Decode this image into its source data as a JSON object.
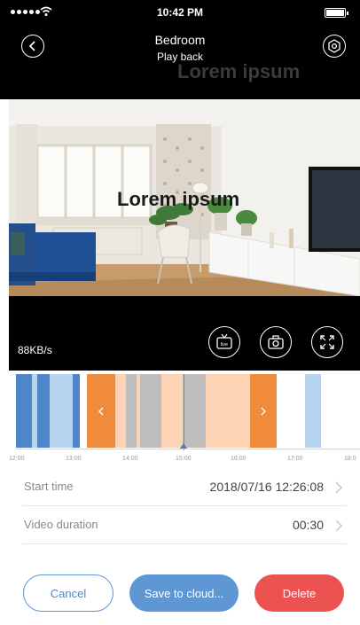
{
  "status_bar": {
    "time": "10:42 PM"
  },
  "nav": {
    "title": "Bedroom",
    "subtitle": "Play back"
  },
  "overlays": {
    "text_1": "Lorem ipsum",
    "text_2": "Lorem ipsum"
  },
  "player": {
    "bitrate": "88KB/s",
    "controls": [
      "live-icon",
      "camera-icon",
      "fullscreen-icon"
    ]
  },
  "timeline": {
    "ticks": [
      "12:00",
      "13:00",
      "14:00",
      "15:00",
      "16:00",
      "17:00",
      "18:0"
    ],
    "colors": {
      "blue": "#4f86c9",
      "light_blue": "#b7d4ee",
      "orange": "#ef8b3a",
      "peach": "#fcd4b5",
      "gray": "#bdbdbd"
    }
  },
  "details": {
    "start_time_label": "Start time",
    "start_time_value": "2018/07/16 12:26:08",
    "duration_label": "Video duration",
    "duration_value": "00:30"
  },
  "actions": {
    "cancel": "Cancel",
    "save": "Save to cloud...",
    "delete": "Delete"
  }
}
